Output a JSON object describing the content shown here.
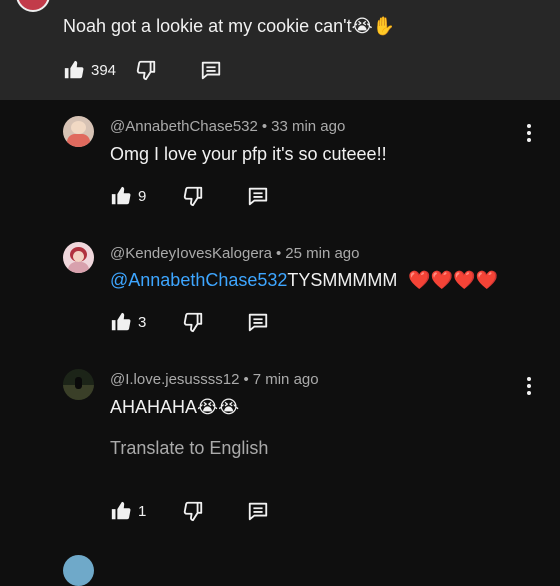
{
  "top_comment": {
    "text": "Noah got a lookie at my cookie can't",
    "emoji": "😭✋",
    "likes": "394"
  },
  "replies": [
    {
      "author": "@AnnabethChase532",
      "time": "33 min ago",
      "text": "Omg I love your pfp it's so cuteee!!",
      "likes": "9"
    },
    {
      "author": "@KendeyIovesKalogera",
      "time": "25 min ago",
      "mention": "@AnnabethChase532",
      "text": "TYSMMMMM",
      "emoji": "❤️❤️❤️❤️",
      "likes": "3"
    },
    {
      "author": "@I.love.jesussss12",
      "time": "7 min ago",
      "text": "AHAHAHA",
      "emoji": "😭😭",
      "translate": "Translate to English",
      "likes": "1"
    }
  ],
  "icons": [
    "thumb-up-icon",
    "thumb-down-icon",
    "reply-icon",
    "more-vert-icon"
  ],
  "colors": {
    "background": "#0f0f0f",
    "highlight": "#272727",
    "mention": "#3ea6ff",
    "meta": "#aaaaaa"
  }
}
